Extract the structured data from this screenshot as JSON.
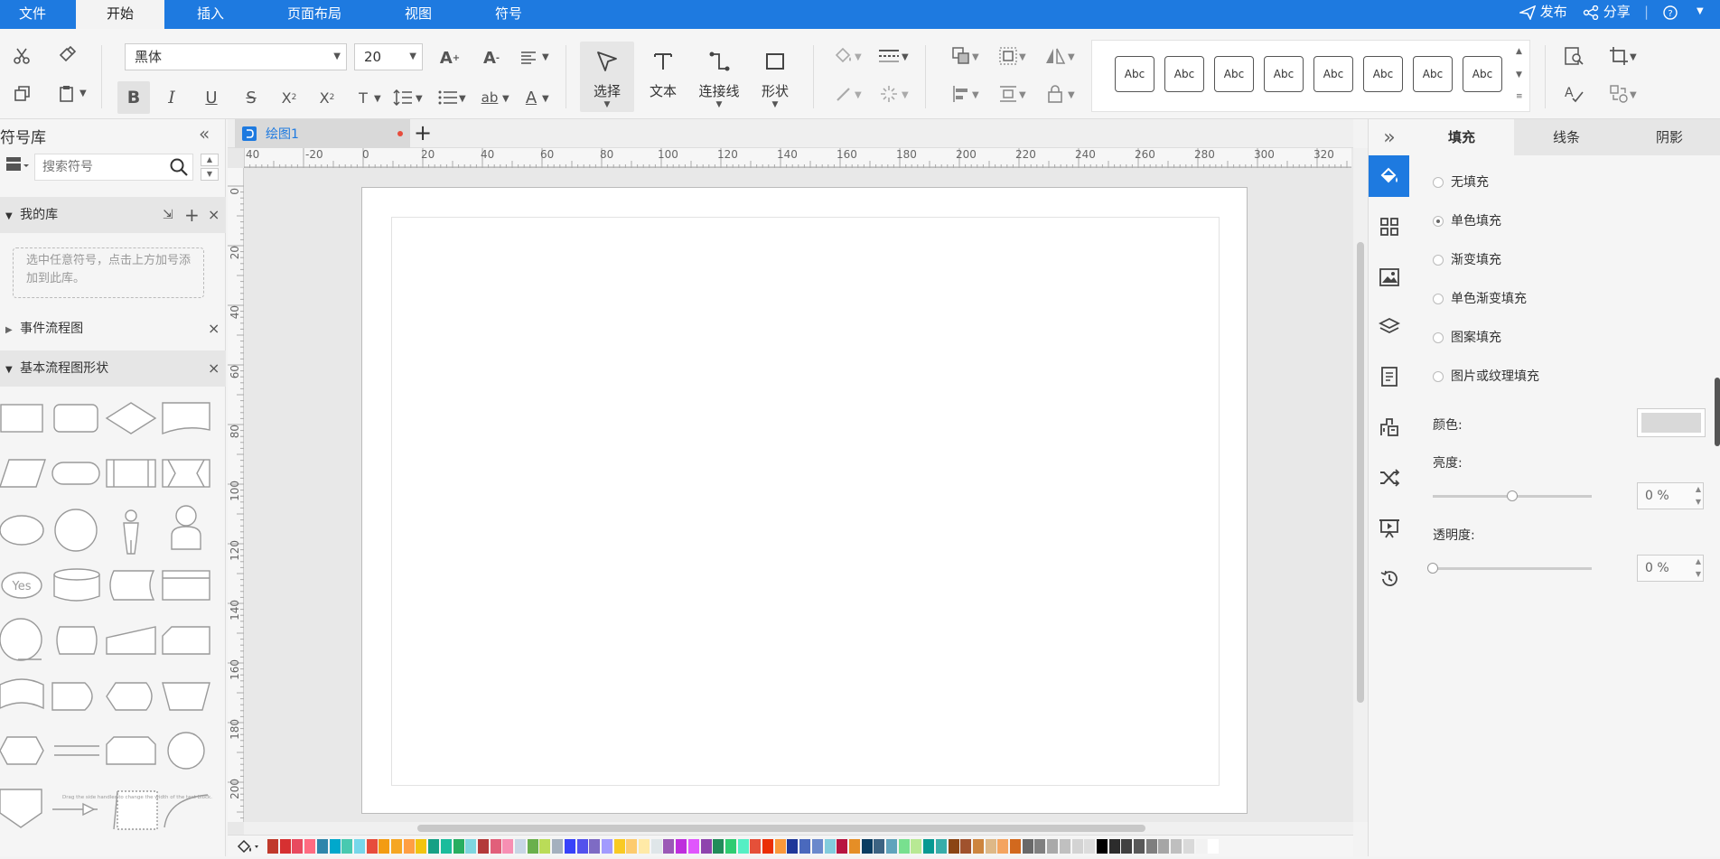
{
  "menubar": {
    "tabs": [
      "文件",
      "开始",
      "插入",
      "页面布局",
      "视图",
      "符号"
    ],
    "active_tab": "开始",
    "publish": "发布",
    "share": "分享"
  },
  "toolbar": {
    "font_family": "黑体",
    "font_size": "20",
    "tools": {
      "select": "选择",
      "text": "文本",
      "connector": "连接线",
      "shape": "形状"
    },
    "style_presets": [
      "Abc",
      "Abc",
      "Abc",
      "Abc",
      "Abc",
      "Abc",
      "Abc",
      "Abc"
    ]
  },
  "left_panel": {
    "title": "符号库",
    "search_placeholder": "搜索符号",
    "my_library": "我的库",
    "my_library_hint": "选中任意符号，点击上方加号添加到此库。",
    "sections": [
      "事件流程图",
      "基本流程图形状"
    ],
    "shape_labels": {
      "yes": "Yes",
      "text_block": "Drag the side handles to change the width of the text block."
    }
  },
  "document": {
    "tab_name": "绘图1",
    "ruler_h": [
      "40",
      "-20",
      "0",
      "20",
      "40",
      "60",
      "80",
      "100",
      "120",
      "140",
      "160",
      "180",
      "200",
      "220",
      "240",
      "260",
      "280",
      "300",
      "320"
    ],
    "ruler_v": [
      "0",
      "20",
      "40",
      "60",
      "80",
      "100",
      "120",
      "140",
      "160",
      "180",
      "200"
    ]
  },
  "right_panel": {
    "tabs": [
      "填充",
      "线条",
      "阴影"
    ],
    "active_tab": "填充",
    "fill_options": [
      "无填充",
      "单色填充",
      "渐变填充",
      "单色渐变填充",
      "图案填充",
      "图片或纹理填充"
    ],
    "selected_option": "单色填充",
    "color_label": "颜色:",
    "brightness_label": "亮度:",
    "brightness_value": "0 %",
    "brightness_level": 0.5,
    "transparency_label": "透明度:",
    "transparency_value": "0 %",
    "transparency_level": 0
  },
  "colors": {
    "brand": "#1e7ae0",
    "swatch_color": "#d9d9d9"
  },
  "palette": [
    "#c0392b",
    "#d63031",
    "#e84a5f",
    "#ff6b81",
    "#2e86ab",
    "#00a8cc",
    "#48c9b0",
    "#76d7ea",
    "#e74c3c",
    "#f39c12",
    "#f5a623",
    "#ff9f43",
    "#f1c40f",
    "#16a085",
    "#1abc9c",
    "#27ae60",
    "#7ed6df",
    "#b33939",
    "#e15f7a",
    "#f78fb3",
    "#c8d6e5",
    "#6ab04c",
    "#badc58",
    "#a4b0be",
    "#3742fa",
    "#5352ed",
    "#7e6bc4",
    "#a29bfe",
    "#f9ca24",
    "#fdcb6e",
    "#ffeaa7",
    "#dfe6e9",
    "#9b59b6",
    "#be2edd",
    "#e056fd",
    "#8e44ad",
    "#218c5a",
    "#2ecc71",
    "#55efc4",
    "#e55039",
    "#eb2f06",
    "#fa983a",
    "#1e3799",
    "#4a69bd",
    "#6a89cc",
    "#82ccdd",
    "#b71540",
    "#e58e26",
    "#0a3d62",
    "#3c6382",
    "#60a3bc",
    "#78e08f",
    "#b8e994",
    "#079992",
    "#38ada9",
    "#8b4513",
    "#a0522d",
    "#cd853f",
    "#deb887",
    "#f4a460",
    "#d2691e",
    "#696969",
    "#808080",
    "#a9a9a9",
    "#c0c0c0",
    "#d3d3d3",
    "#dcdcdc",
    "#000000",
    "#2c2c2c",
    "#404040",
    "#595959",
    "#7f7f7f",
    "#a6a6a6",
    "#bfbfbf",
    "#d9d9d9",
    "#f2f2f2",
    "#ffffff"
  ]
}
